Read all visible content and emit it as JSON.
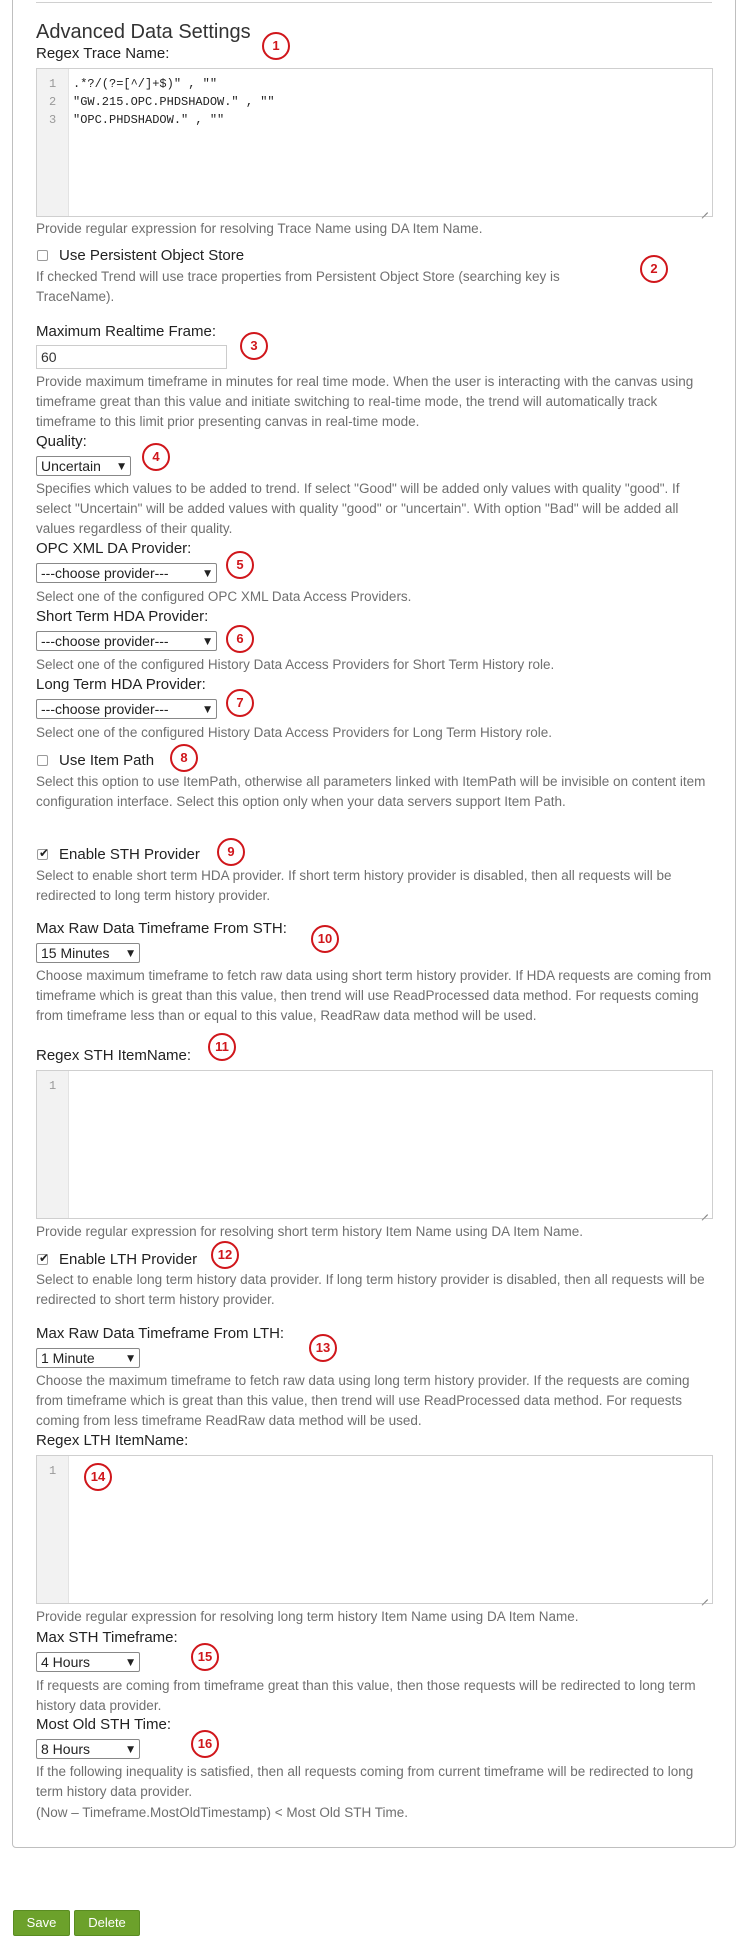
{
  "section": {
    "title": "Advanced Data Settings"
  },
  "regex_trace": {
    "label": "Regex Trace Name:",
    "line_numbers": [
      "1",
      "2",
      "3"
    ],
    "lines": [
      ".*?/(?=[^/]+$)\" , \"\"",
      "\"GW.215.OPC.PHDSHADOW.\" , \"\"",
      "\"OPC.PHDSHADOW.\" , \"\""
    ],
    "help": "Provide regular expression for resolving Trace Name using DA Item Name."
  },
  "persistent_store": {
    "label": "Use Persistent Object Store",
    "checked": false,
    "help": "If checked Trend will use trace properties from Persistent Object Store (searching key is TraceName)."
  },
  "max_realtime": {
    "label": "Maximum Realtime Frame:",
    "value": "60",
    "help": "Provide maximum timeframe in minutes for real time mode. When the user is interacting with the canvas using timeframe great than this value and initiate switching to real-time mode, the trend will automatically track timeframe to this limit prior presenting canvas in real-time mode."
  },
  "quality": {
    "label": "Quality:",
    "selected": "Uncertain",
    "help": "Specifies which values to be added to trend. If select \"Good\" will be added only values with quality \"good\". If select \"Uncertain\" will be added values with quality \"good\" or \"uncertain\". With option \"Bad\" will be added all values regardless of their quality."
  },
  "opc_xml": {
    "label": "OPC XML DA Provider:",
    "selected": "---choose provider---",
    "help": "Select one of the configured OPC XML Data Access Providers."
  },
  "sth_hda": {
    "label": "Short Term HDA Provider:",
    "selected": "---choose provider---",
    "help": "Select one of the configured History Data Access Providers for Short Term History role."
  },
  "lth_hda": {
    "label": "Long Term HDA Provider:",
    "selected": "---choose provider---",
    "help": "Select one of the configured History Data Access Providers for Long Term History role."
  },
  "item_path": {
    "label": "Use Item Path",
    "checked": false,
    "help": "Select this option to use ItemPath, otherwise all parameters linked with ItemPath will be invisible on content item configuration interface. Select this option only when your data servers support Item Path."
  },
  "enable_sth": {
    "label": "Enable STH Provider",
    "checked": true,
    "help": "Select to enable short term HDA provider. If short term history provider is disabled, then all requests will be redirected to long term history provider."
  },
  "raw_sth": {
    "label": "Max Raw Data Timeframe From STH:",
    "selected": "15 Minutes",
    "help": "Choose maximum timeframe to fetch raw data using short term history provider. If HDA requests are coming from timeframe which is great than this value, then trend will use ReadProcessed data method. For requests coming from timeframe less than or equal to this value, ReadRaw data method will be used."
  },
  "regex_sth": {
    "label": "Regex STH ItemName:",
    "line_numbers": [
      "1"
    ],
    "help": "Provide regular expression for resolving short term history Item Name using DA Item Name."
  },
  "enable_lth": {
    "label": "Enable LTH Provider",
    "checked": true,
    "help": "Select to enable long term history data provider. If long term history provider is disabled, then all requests will be redirected to short term history provider."
  },
  "raw_lth": {
    "label": "Max Raw Data Timeframe From LTH:",
    "selected": "1 Minute",
    "help": "Choose the maximum timeframe to fetch raw data using long term history provider. If the requests are coming from timeframe which is great than this value, then trend will use ReadProcessed data method. For requests coming from less timeframe ReadRaw data method will be used."
  },
  "regex_lth": {
    "label": "Regex LTH ItemName:",
    "line_numbers": [
      "1"
    ],
    "help": "Provide regular expression for resolving long term history Item Name using DA Item Name."
  },
  "max_sth": {
    "label": "Max STH Timeframe:",
    "selected": "4 Hours",
    "help": "If requests are coming from timeframe great than this value, then those requests will be redirected to long term history data provider."
  },
  "old_sth": {
    "label": "Most Old STH Time:",
    "selected": "8 Hours",
    "help": "If the following inequality is satisfied, then all requests coming from current timeframe will be redirected to long term history data provider.",
    "formula": "(Now – Timeframe.MostOldTimestamp) < Most Old STH Time."
  },
  "markers": [
    "1",
    "2",
    "3",
    "4",
    "5",
    "6",
    "7",
    "8",
    "9",
    "10",
    "11",
    "12",
    "13",
    "14",
    "15",
    "16"
  ],
  "buttons": {
    "save": "Save",
    "delete": "Delete"
  },
  "colors": {
    "marker_red": "#d0161b",
    "button_green": "#6ca12b"
  },
  "icons": {
    "dropdown": "triangle-down-icon",
    "check": "check-icon",
    "resize": "resize-grip-icon"
  }
}
